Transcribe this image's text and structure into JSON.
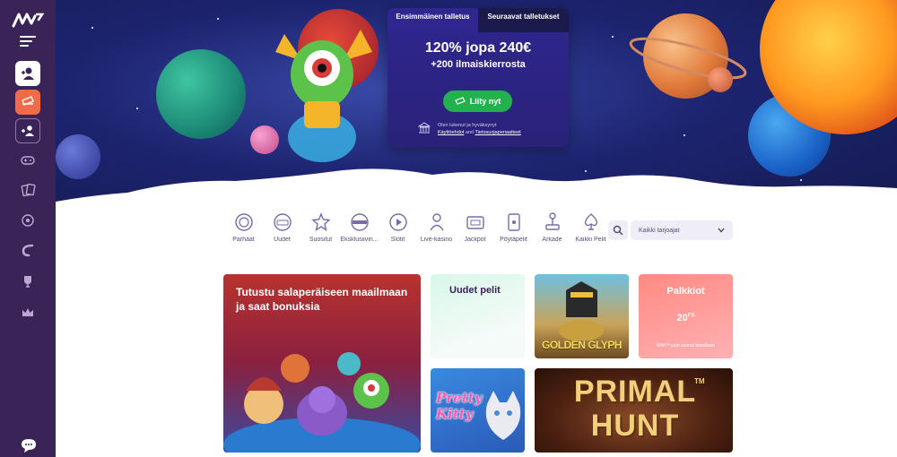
{
  "promo": {
    "tab_first": "Ensimmäinen talletus",
    "tab_next": "Seuraavat talletukset",
    "headline": "120% jopa 240€",
    "subline": "+200 ilmaiskierrosta",
    "join_label": "Liity nyt",
    "terms_prefix": "Olen lukenut ja hyväksynyt",
    "terms_link": "Käyttöehdot",
    "terms_and": "and",
    "privacy_link": "Tietosuojaperiaatteet"
  },
  "categories": [
    {
      "label": "Parhaat",
      "icon": "rosette-icon"
    },
    {
      "label": "Uudet",
      "icon": "new-badge-icon"
    },
    {
      "label": "Suositut",
      "icon": "star-icon"
    },
    {
      "label": "Eksklusiivin...",
      "icon": "exclusive-icon"
    },
    {
      "label": "Slotit",
      "icon": "play-icon"
    },
    {
      "label": "Live-kasino",
      "icon": "dealer-icon"
    },
    {
      "label": "Jackpot",
      "icon": "jackpot-icon"
    },
    {
      "label": "Pöytäpelit",
      "icon": "cards-icon"
    },
    {
      "label": "Arkade",
      "icon": "joystick-icon"
    },
    {
      "label": "Kaikki Pelit",
      "icon": "spade-icon"
    }
  ],
  "provider_select": {
    "value": "Kaikki tarjoajat"
  },
  "tiles": {
    "feature": "Tutustu salaperäiseen maailmaan ja saat bonuksia",
    "new_games": "Uudet pelit",
    "golden_glyph": "GOLDEN GLYPH",
    "rewards": "Palkkiot",
    "rewards_amount": "20",
    "rewards_unit": "FS",
    "rewards_note": "Wild™ juuri saanut bonuksen",
    "pretty_kitty": "Pretty Kitty",
    "primal_hunt_1": "PRIMAL",
    "primal_hunt_2": "HUNT",
    "primal_tm": "TM"
  },
  "colors": {
    "sidebar": "#3a2357",
    "accent_orange": "#f06b4a",
    "join_green": "#22b14c",
    "promo_panel": "#2f2690"
  }
}
